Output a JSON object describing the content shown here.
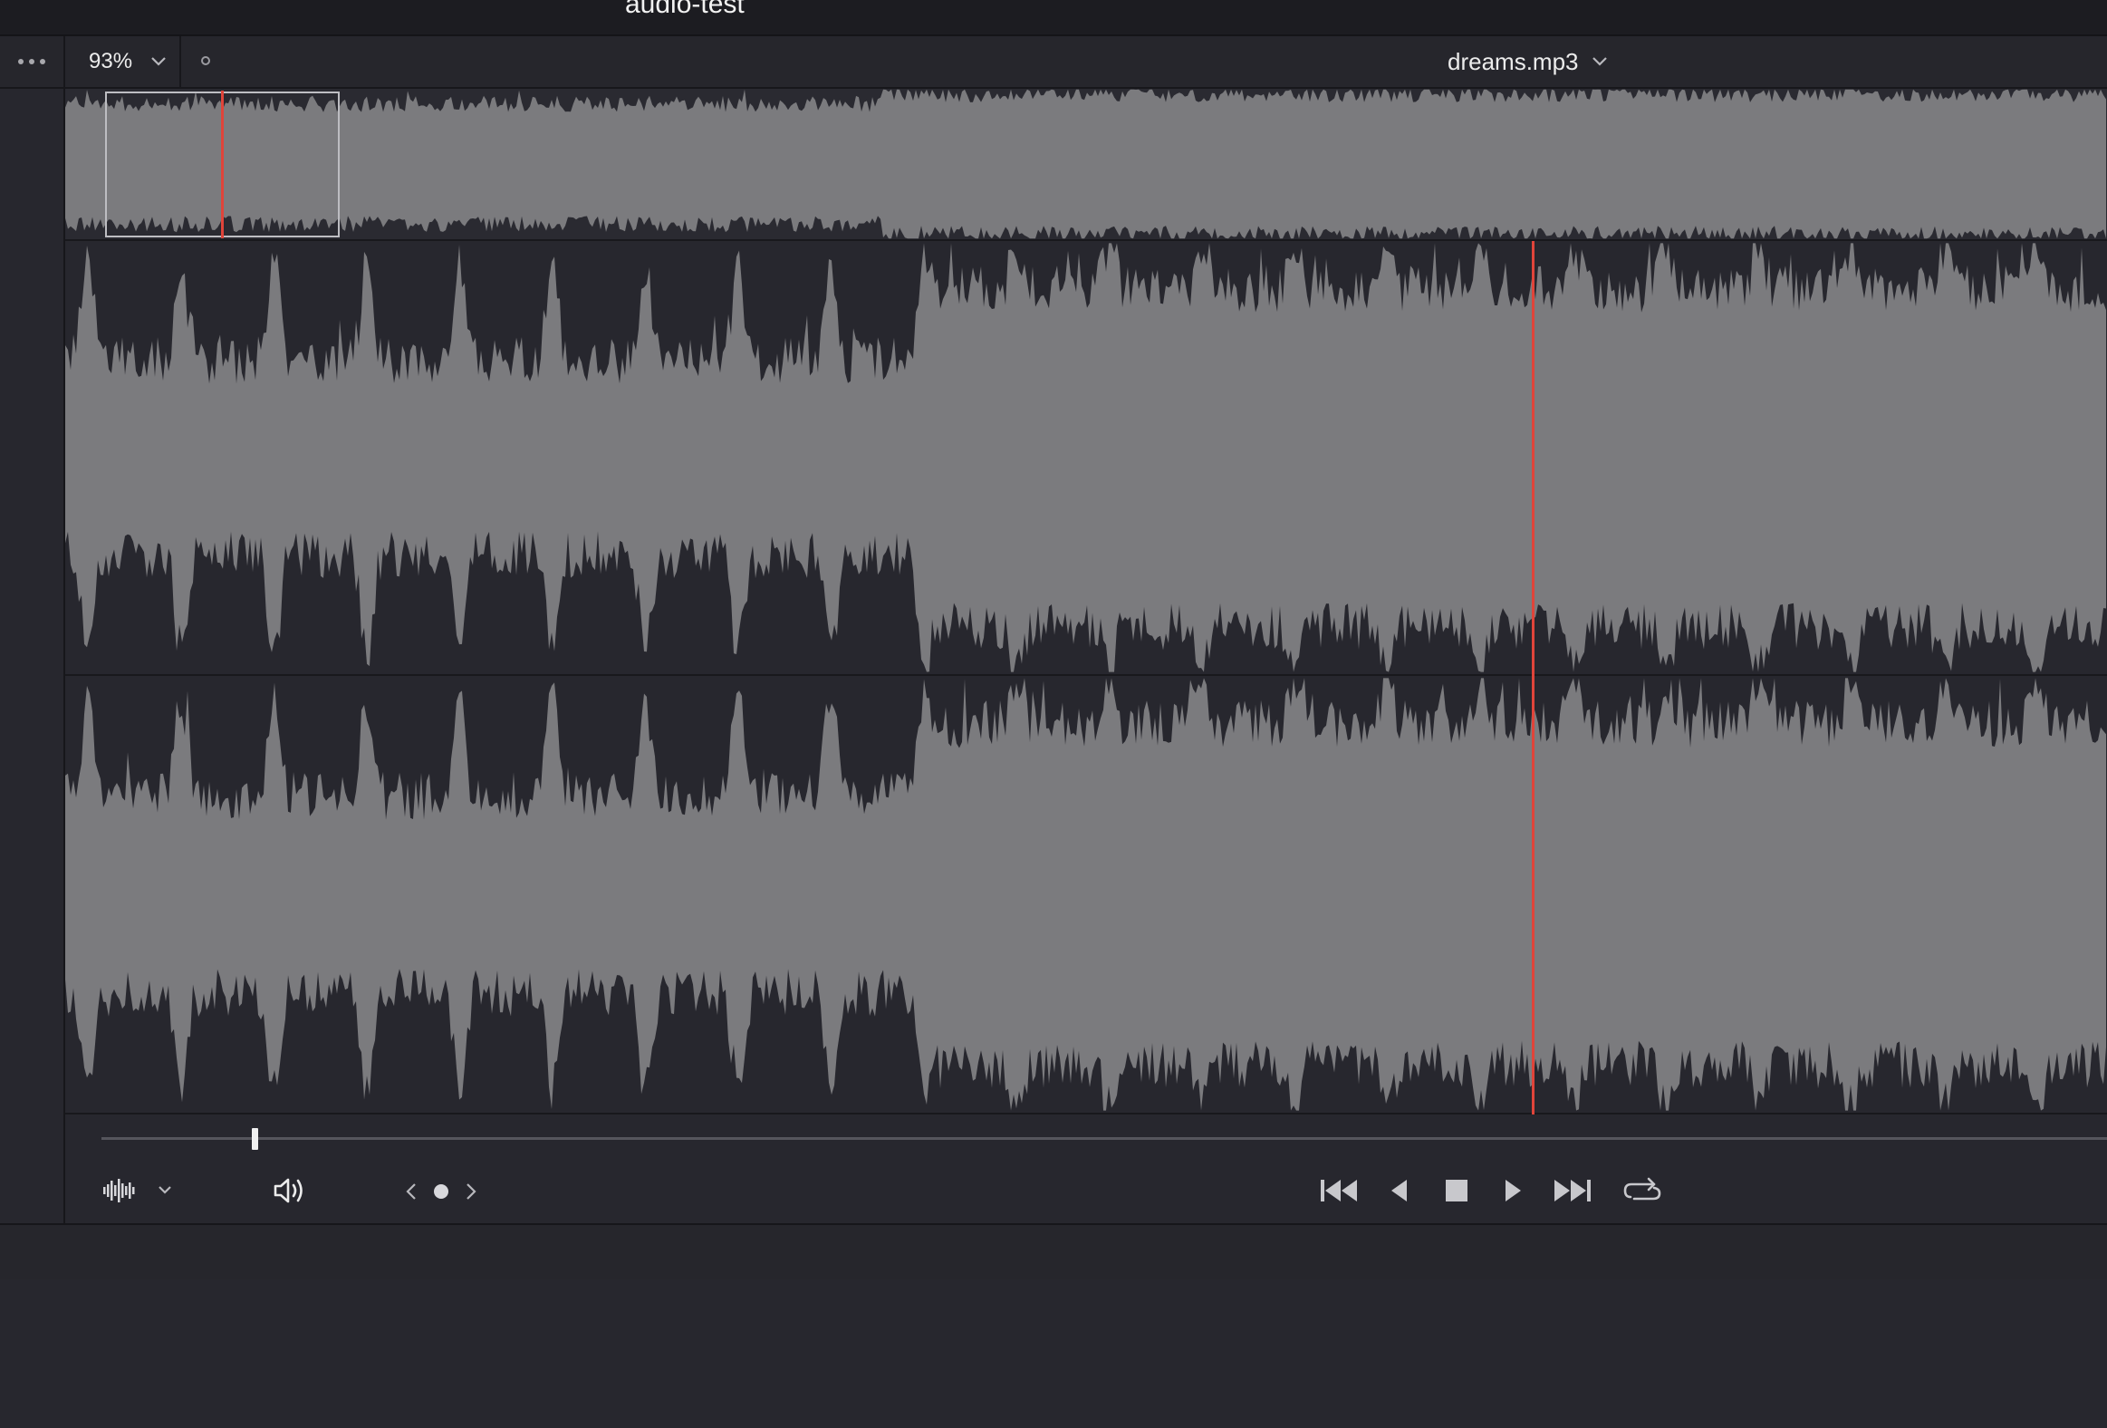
{
  "window": {
    "title": "audio-test"
  },
  "toolbar": {
    "zoom": {
      "value": "93%"
    },
    "file": {
      "name": "dreams.mp3"
    }
  },
  "icons": {
    "more": "more-horizontal-icon",
    "zoom_dropdown": "chevron-down-icon",
    "file_dropdown": "chevron-down-icon",
    "waveform": "waveform-icon",
    "volume": "speaker-icon",
    "prev_marker": "chevron-left-icon",
    "marker": "marker-dot-icon",
    "next_marker": "chevron-right-icon",
    "skip_start": "skip-to-start-icon",
    "step_back": "step-back-icon",
    "stop": "stop-icon",
    "play": "play-icon",
    "skip_end": "skip-to-end-icon",
    "loop": "loop-icon"
  },
  "colors": {
    "background": "#27272e",
    "waveform": "#7b7b7e",
    "playhead": "#e0443a",
    "text": "#ececec"
  },
  "playback": {
    "position_fraction": 0.72,
    "scrub_fraction": 0.075,
    "overview_window_start_fraction": 0.02,
    "overview_window_end_fraction": 0.137,
    "overview_playhead_fraction": 0.078
  }
}
